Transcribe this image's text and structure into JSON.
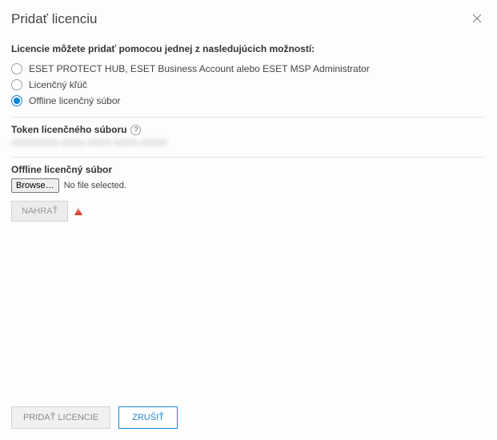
{
  "dialog": {
    "title": "Pridať licenciu"
  },
  "instruction": "Licencie môžete pridať pomocou jednej z nasledujúcich možností:",
  "options": [
    {
      "label": "ESET PROTECT HUB, ESET Business Account alebo ESET MSP Administrator",
      "selected": false
    },
    {
      "label": "Licenčný kľúč",
      "selected": false
    },
    {
      "label": "Offline licenčný súbor",
      "selected": true
    }
  ],
  "token_section": {
    "title": "Token licenčného súboru",
    "value_obscured": "XXXXXXXX-XXXX-XXXX-XXXX-XXXXXXXXXXXX"
  },
  "file_section": {
    "title": "Offline licenčný súbor",
    "browse_label": "Browse…",
    "file_status": "No file selected.",
    "upload_label": "Nahrať",
    "upload_enabled": false,
    "has_warning": true
  },
  "footer": {
    "add_label": "Pridať licencie",
    "add_enabled": false,
    "cancel_label": "Zrušiť"
  }
}
